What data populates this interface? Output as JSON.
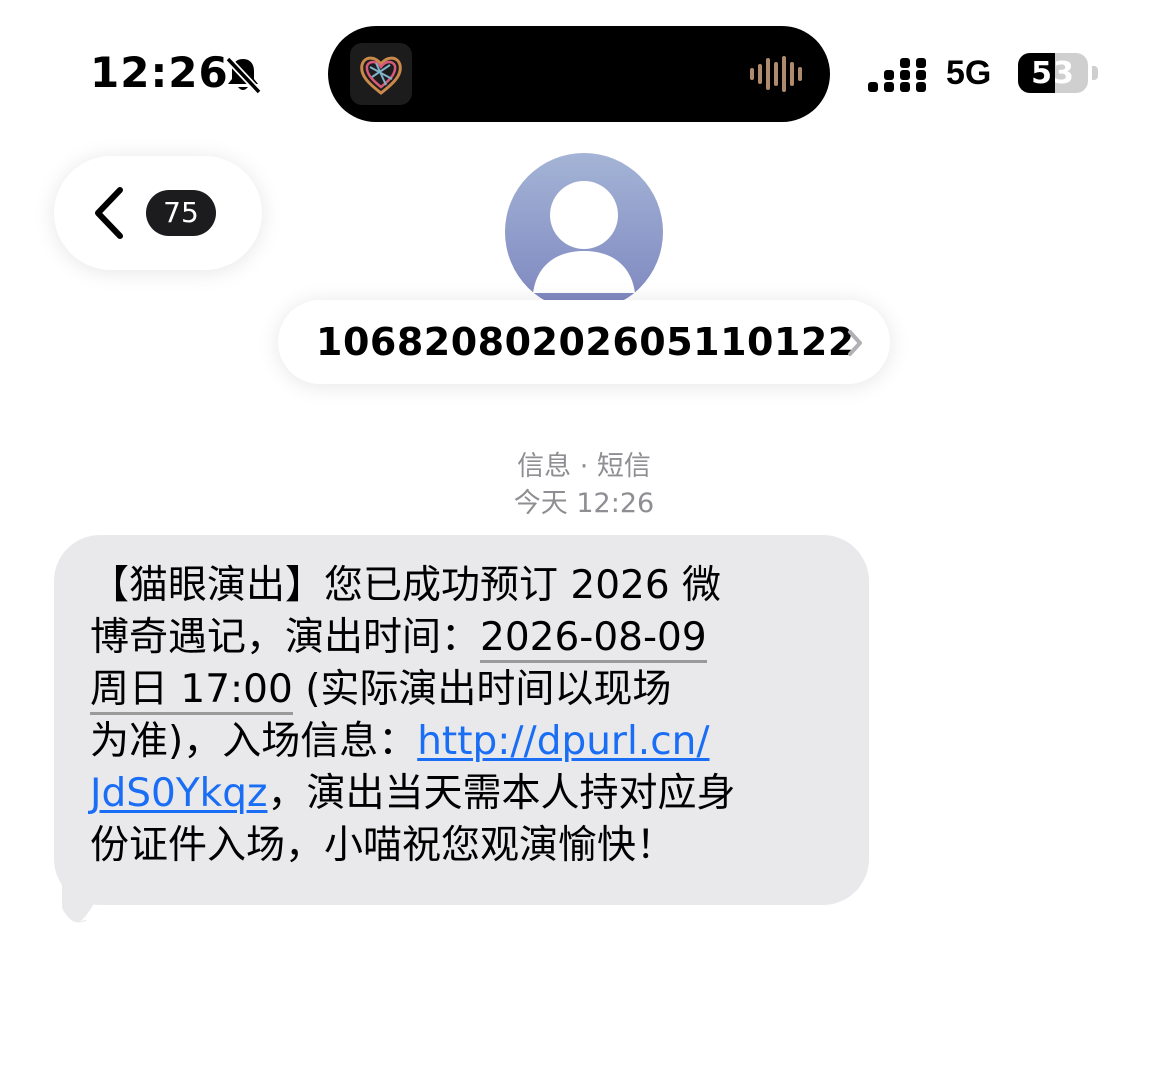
{
  "status_bar": {
    "time": "12:26",
    "network": "5G",
    "battery_percent": 53,
    "battery_label": "53"
  },
  "header": {
    "unread_count": "75",
    "sender_number": "106820802026051 10122"
  },
  "meta": {
    "service": "信息 · 短信",
    "time": "今天 12:26"
  },
  "message": {
    "lines": [
      [
        "【猫眼演出】您已成功预订 2026 微"
      ],
      [
        "博奇遇记，演出时间：",
        "2026-08-09"
      ],
      [
        "周日 17:00",
        " (实际演出时间以现场"
      ],
      [
        "为准)，入场信息：",
        "http://dpurl.cn/"
      ],
      [
        "JdS0Ykqz",
        "，演出当天需本人持对应身"
      ],
      [
        "份证件入场，小喵祝您观演愉快！"
      ]
    ]
  },
  "colors": {
    "bubble": "#e9e9eb",
    "link": "#1a6ef5",
    "meta": "#8e8e93",
    "avatar_top": "#a4b4d6",
    "avatar_bottom": "#7d86bf"
  }
}
